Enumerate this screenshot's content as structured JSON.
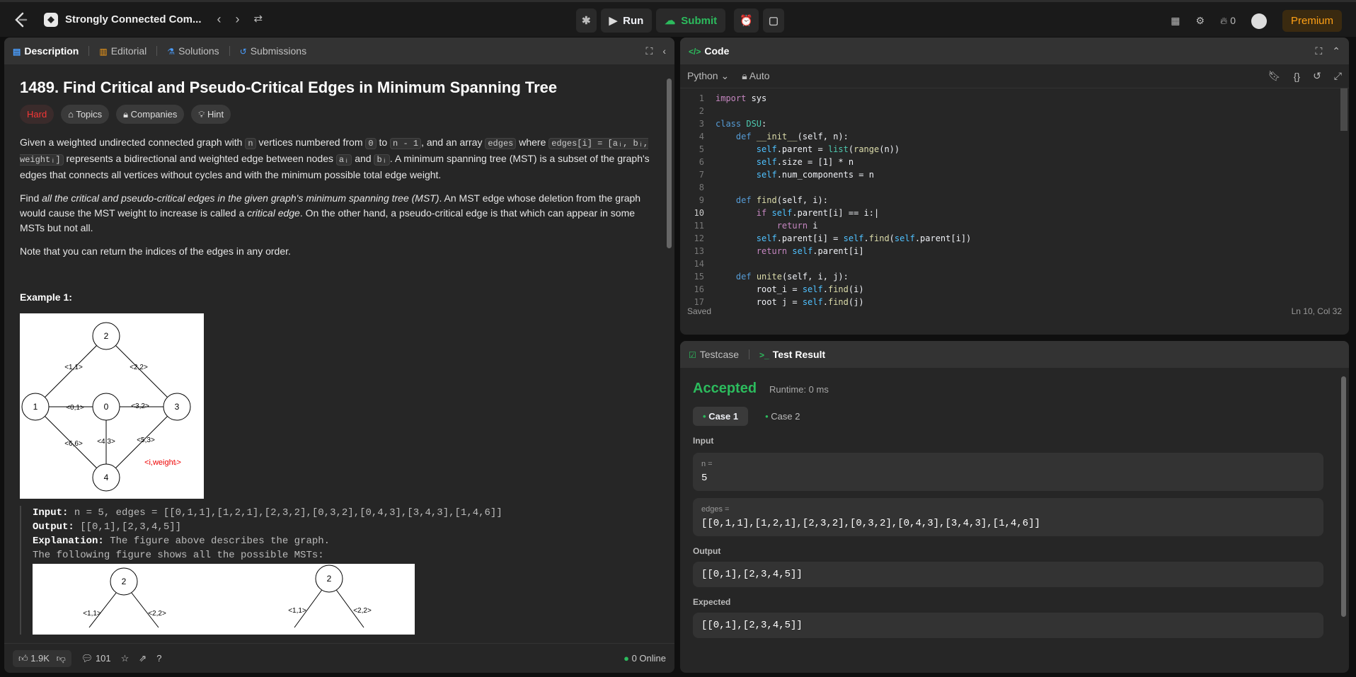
{
  "topbar": {
    "problem_title": "Strongly Connected Com...",
    "run": "Run",
    "submit": "Submit",
    "streak": "0",
    "premium": "Premium"
  },
  "left_tabs": {
    "description": "Description",
    "editorial": "Editorial",
    "solutions": "Solutions",
    "submissions": "Submissions"
  },
  "problem": {
    "title": "1489. Find Critical and Pseudo-Critical Edges in Minimum Spanning Tree",
    "difficulty": "Hard",
    "topics": "Topics",
    "companies": "Companies",
    "hint": "Hint",
    "p1a": "Given a weighted undirected connected graph with",
    "n": "n",
    "p1b": "vertices numbered from",
    "zero": "0",
    "to": "to",
    "n1": "n - 1",
    "p1c": ", and an array",
    "edges": "edges",
    "where": "where",
    "edges_def": "edges[i] = [aᵢ, bᵢ, weightᵢ]",
    "p1d": "represents a bidirectional and weighted edge between nodes",
    "ai": "aᵢ",
    "and": "and",
    "bi": "bᵢ",
    "p1e": ". A minimum spanning tree (MST) is a subset of the graph's edges that connects all vertices without cycles and with the minimum possible total edge weight.",
    "p2a": "Find",
    "p2i": "all the critical and pseudo-critical edges in the given graph's minimum spanning tree (MST)",
    "p2b": ". An MST edge whose deletion from the graph would cause the MST weight to increase is called a",
    "p2i2": "critical edge",
    "p2c": ". On the other hand, a pseudo-critical edge is that which can appear in some MSTs but not all.",
    "p3": "Note that you can return the indices of the edges in any order.",
    "example_title": "Example 1:",
    "ex_input_label": "Input:",
    "ex_input": "n = 5, edges = [[0,1,1],[1,2,1],[2,3,2],[0,3,2],[0,4,3],[3,4,3],[1,4,6]]",
    "ex_output_label": "Output:",
    "ex_output": "[[0,1],[2,3,4,5]]",
    "ex_expl_label": "Explanation:",
    "ex_expl": "The figure above describes the graph.",
    "ex_expl2": "The following figure shows all the possible MSTs:"
  },
  "graph": {
    "nodes": [
      "0",
      "1",
      "2",
      "3",
      "4"
    ],
    "edge_labels": [
      "<1,1>",
      "<2,2>",
      "<0,1>",
      "<3,2>",
      "<6,6>",
      "<4,3>",
      "<5,3>"
    ],
    "legend": "<i,weightᵢ>"
  },
  "mst_fig": {
    "node": "2",
    "l1": "<1,1>",
    "l2": "<2,2>"
  },
  "footer": {
    "likes": "1.9K",
    "comments": "101",
    "online": "0 Online"
  },
  "code": {
    "title": "Code",
    "lang": "Python",
    "auto": "Auto",
    "status": "Saved",
    "cursor": "Ln 10, Col 32"
  },
  "tests": {
    "testcase": "Testcase",
    "result": "Test Result",
    "accepted": "Accepted",
    "runtime": "Runtime: 0 ms",
    "case1": "Case 1",
    "case2": "Case 2",
    "input": "Input",
    "n_label": "n =",
    "n_val": "5",
    "edges_label": "edges =",
    "edges_val": "[[0,1,1],[1,2,1],[2,3,2],[0,3,2],[0,4,3],[3,4,3],[1,4,6]]",
    "output": "Output",
    "output_val": "[[0,1],[2,3,4,5]]",
    "expected": "Expected",
    "expected_val": "[[0,1],[2,3,4,5]]"
  }
}
